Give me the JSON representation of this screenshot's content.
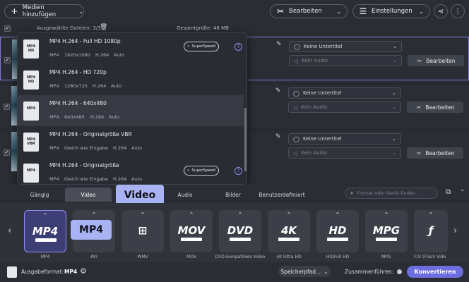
{
  "toolbar": {
    "add_media": "Medien hinzufügen",
    "edit": "Bearbeiten",
    "settings": "Einstellungen"
  },
  "info": {
    "selected_files": "Ausgewählte Dateien: 3/3",
    "total_size": "Gesamtgröße: 48 MB"
  },
  "rows": [
    {
      "subtitle": "Keine Untertitel",
      "audio": "Kein Audio",
      "edit": "Bearbeiten"
    },
    {
      "subtitle": "Keine Untertitel",
      "audio": "Kein Audio",
      "edit": "Bearbeiten"
    },
    {
      "subtitle": "Keine Untertitel",
      "audio": "Kein Audio",
      "edit": "Bearbeiten"
    }
  ],
  "presets": [
    {
      "name": "MP4 H.264 - Full HD 1080p",
      "fmt": "MP4",
      "res": "1920x1080",
      "codec": "H.264",
      "audio": "Auto",
      "superspeed": "SuperSpeed",
      "icon_top": "MP4",
      "icon_bottom": "HD"
    },
    {
      "name": "MP4 H.264 - HD 720p",
      "fmt": "MP4",
      "res": "1280x720",
      "codec": "H.264",
      "audio": "Auto",
      "icon_top": "MP4",
      "icon_bottom": "HD"
    },
    {
      "name": "MP4 H.264 - 640x480",
      "fmt": "MP4",
      "res": "640x480",
      "codec": "H.264",
      "audio": "Auto",
      "icon_top": "MP4",
      "icon_bottom": ""
    },
    {
      "name": "MP4 H.264 - Originalgröße VBR",
      "fmt": "MP4",
      "res": "Gleich wie Eingabe",
      "codec": "H.264",
      "audio": "Auto",
      "icon_top": "MP4",
      "icon_bottom": "VBR"
    },
    {
      "name": "MP4 H.264 - Originalgröße",
      "fmt": "MP4",
      "res": "Gleich wie Eingabe",
      "codec": "H.264",
      "audio": "Auto",
      "superspeed": "SuperSpeed",
      "icon_top": "MP4",
      "icon_bottom": ""
    }
  ],
  "tabs": [
    "Gängig",
    "Video",
    "Audio",
    "Bilder",
    "Benutzerdefiniert"
  ],
  "tooltips": {
    "video": "Video",
    "mp4": "MP4"
  },
  "search_placeholder": "Format oder Gerät finden...",
  "formats": [
    {
      "logo": "MP4",
      "label": "MP4"
    },
    {
      "logo": "",
      "label": "AVI"
    },
    {
      "logo": "",
      "label": "WMV"
    },
    {
      "logo": "MOV",
      "label": "MOV"
    },
    {
      "logo": "DVD",
      "label": "DVD-kompatibles Video"
    },
    {
      "logo": "4K",
      "label": "4K Ultra HD"
    },
    {
      "logo": "HD",
      "label": "HD/Full HD"
    },
    {
      "logo": "MPG",
      "label": "MPG"
    },
    {
      "logo": "",
      "label": "FLV (Flash Vide"
    }
  ],
  "bottom": {
    "output_label": "Ausgabeformat:",
    "output_value": "MP4",
    "save_path": "Speicherpfad...",
    "merge": "Zusammenführen:",
    "convert": "Konvertieren"
  },
  "colors": {
    "accent": "#7c7ee8",
    "tooltip": "#a9b2f2",
    "convert": "#6d6fe0"
  }
}
